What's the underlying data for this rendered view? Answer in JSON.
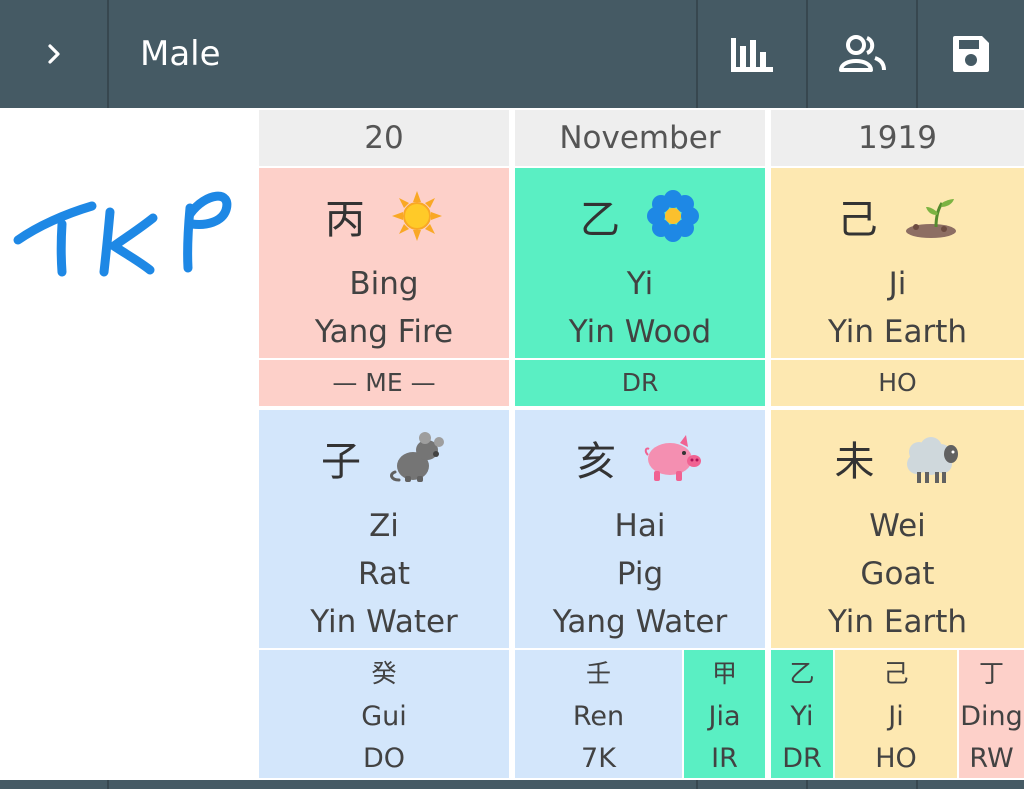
{
  "toolbar": {
    "expand_icon": "chevron-right-icon",
    "gender": "Male",
    "chart_icon": "bar-chart-icon",
    "people_icon": "people-icon",
    "save_icon": "floppy-disk-save-icon"
  },
  "logo_text": "TKP",
  "columns": [
    {
      "header": "20",
      "stem": {
        "char": "丙",
        "pinyin": "Bing",
        "element": "Yang Fire",
        "icon": "sun-icon"
      },
      "god": "— ME —",
      "branch": {
        "char": "子",
        "pinyin": "Zi",
        "animal": "Rat",
        "element": "Yin Water",
        "icon": "rat-icon"
      },
      "hidden": [
        {
          "char": "癸",
          "pinyin": "Gui",
          "god": "DO"
        }
      ]
    },
    {
      "header": "November",
      "stem": {
        "char": "乙",
        "pinyin": "Yi",
        "element": "Yin Wood",
        "icon": "blue-flower-icon"
      },
      "god": "DR",
      "branch": {
        "char": "亥",
        "pinyin": "Hai",
        "animal": "Pig",
        "element": "Yang Water",
        "icon": "pig-icon"
      },
      "hidden": [
        {
          "char": "壬",
          "pinyin": "Ren",
          "god": "7K"
        },
        {
          "char": "甲",
          "pinyin": "Jia",
          "god": "IR"
        }
      ]
    },
    {
      "header": "1919",
      "stem": {
        "char": "己",
        "pinyin": "Ji",
        "element": "Yin Earth",
        "icon": "sprout-icon"
      },
      "god": "HO",
      "branch": {
        "char": "未",
        "pinyin": "Wei",
        "animal": "Goat",
        "element": "Yin Earth",
        "icon": "sheep-icon"
      },
      "hidden": [
        {
          "char": "乙",
          "pinyin": "Yi",
          "god": "DR"
        },
        {
          "char": "己",
          "pinyin": "Ji",
          "god": "HO"
        },
        {
          "char": "丁",
          "pinyin": "Ding",
          "god": "RW"
        }
      ]
    }
  ],
  "colors": {
    "toolbar": "#455a64",
    "fire": "#fdd0c9",
    "wood": "#5aefc3",
    "earth": "#fde8b1",
    "water": "#d3e6fb",
    "logo": "#1e88e5"
  }
}
